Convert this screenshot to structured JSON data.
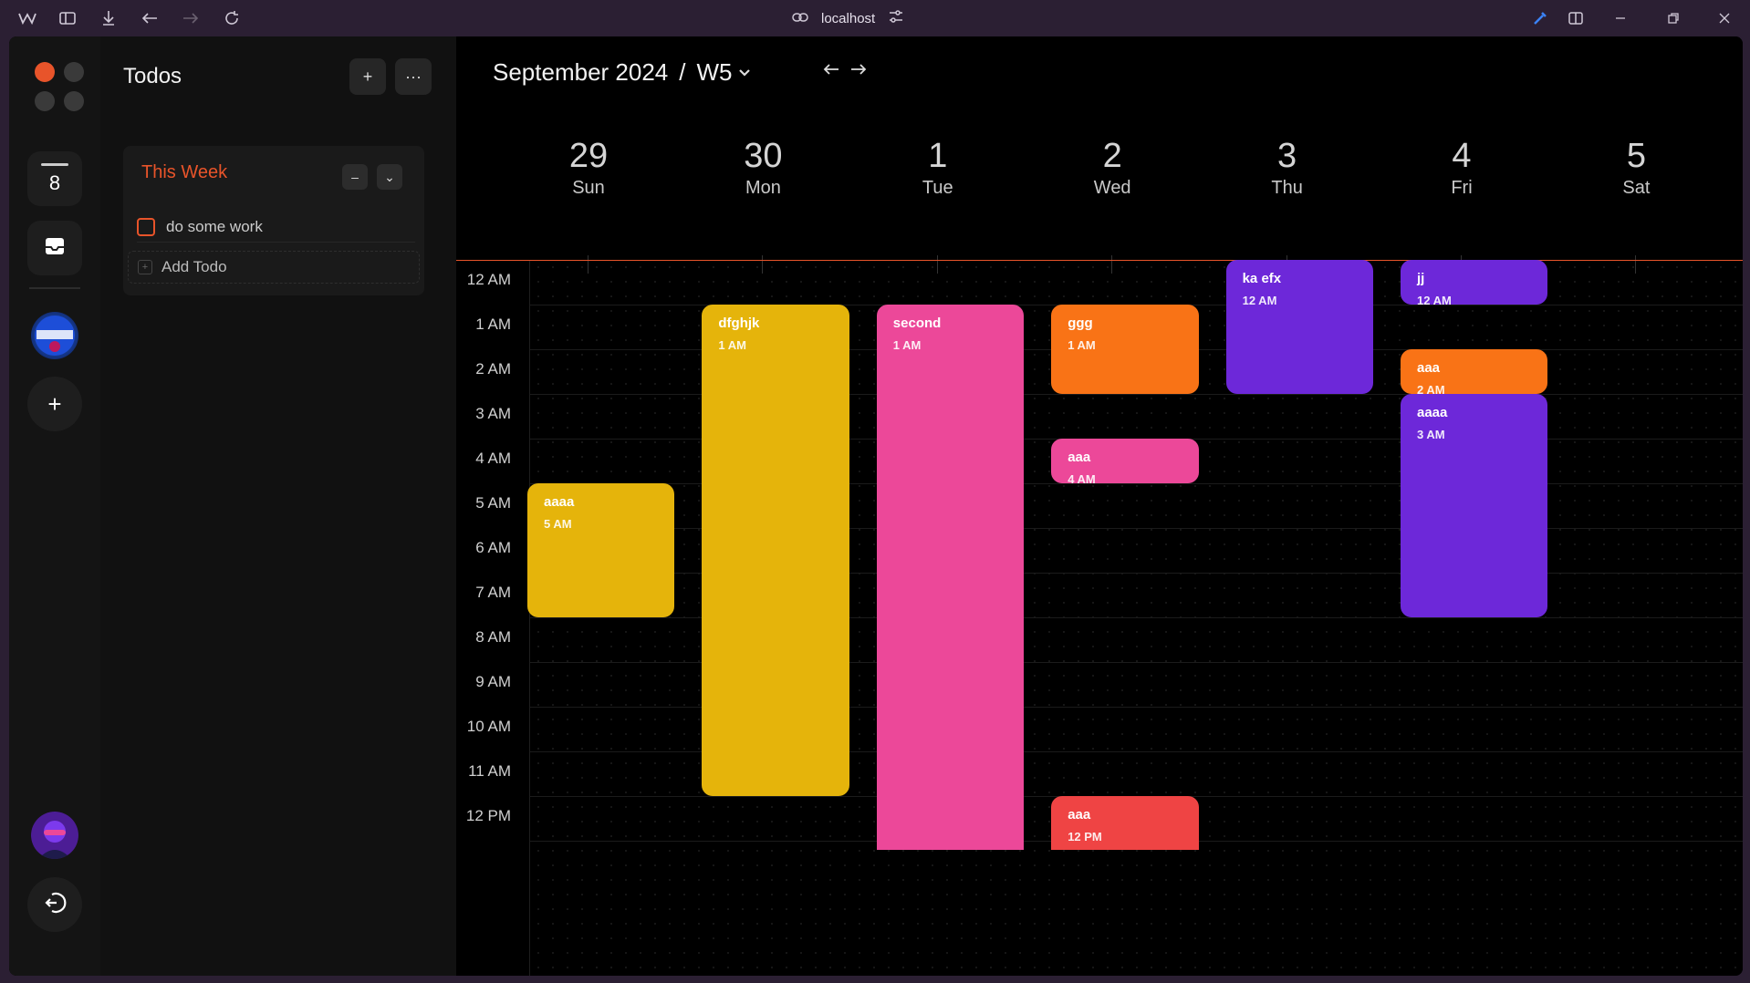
{
  "browser": {
    "url": "localhost"
  },
  "rail": {
    "badge_number": "8"
  },
  "todos": {
    "title": "Todos",
    "add_label": "+",
    "more_label": "···",
    "section": {
      "title": "This Week",
      "collapse_label": "–",
      "expand_label": "⌄",
      "items": [
        {
          "label": "do some work",
          "done": false
        }
      ],
      "add_todo_label": "Add Todo"
    }
  },
  "calendar": {
    "month_label": "September 2024",
    "separator": "/",
    "week_label": "W5",
    "days": [
      {
        "num": "29",
        "name": "Sun"
      },
      {
        "num": "30",
        "name": "Mon"
      },
      {
        "num": "1",
        "name": "Tue"
      },
      {
        "num": "2",
        "name": "Wed"
      },
      {
        "num": "3",
        "name": "Thu"
      },
      {
        "num": "4",
        "name": "Fri"
      },
      {
        "num": "5",
        "name": "Sat"
      }
    ],
    "hours": [
      "12 AM",
      "1 AM",
      "2 AM",
      "3 AM",
      "4 AM",
      "5 AM",
      "6 AM",
      "7 AM",
      "8 AM",
      "9 AM",
      "10 AM",
      "11 AM",
      "12 PM"
    ],
    "events": [
      {
        "title": "aaaa",
        "time": "5 AM",
        "day": 0,
        "start": 5,
        "end": 8,
        "color": "#e5b40b"
      },
      {
        "title": "dfghjk",
        "time": "1 AM",
        "day": 1,
        "start": 1,
        "end": 12,
        "color": "#e5b40b"
      },
      {
        "title": "second",
        "time": "1 AM",
        "day": 2,
        "start": 1,
        "end": 13.2,
        "color": "#ec4899"
      },
      {
        "title": "ggg",
        "time": "1 AM",
        "day": 3,
        "start": 1,
        "end": 3,
        "color": "#f97316"
      },
      {
        "title": "aaa",
        "time": "4 AM",
        "day": 3,
        "start": 4,
        "end": 5,
        "color": "#ec4899"
      },
      {
        "title": "aaa",
        "time": "12 PM",
        "day": 3,
        "start": 12,
        "end": 13.2,
        "color": "#ef4444"
      },
      {
        "title": "ka efx",
        "time": "12 AM",
        "day": 4,
        "start": 0,
        "end": 3,
        "color": "#6d28d9"
      },
      {
        "title": "jj",
        "time": "12 AM",
        "day": 5,
        "start": 0,
        "end": 1,
        "color": "#6d28d9"
      },
      {
        "title": "aaa",
        "time": "2 AM",
        "day": 5,
        "start": 2,
        "end": 3,
        "color": "#f97316"
      },
      {
        "title": "aaaa",
        "time": "3 AM",
        "day": 5,
        "start": 3,
        "end": 8,
        "color": "#6d28d9"
      }
    ]
  }
}
